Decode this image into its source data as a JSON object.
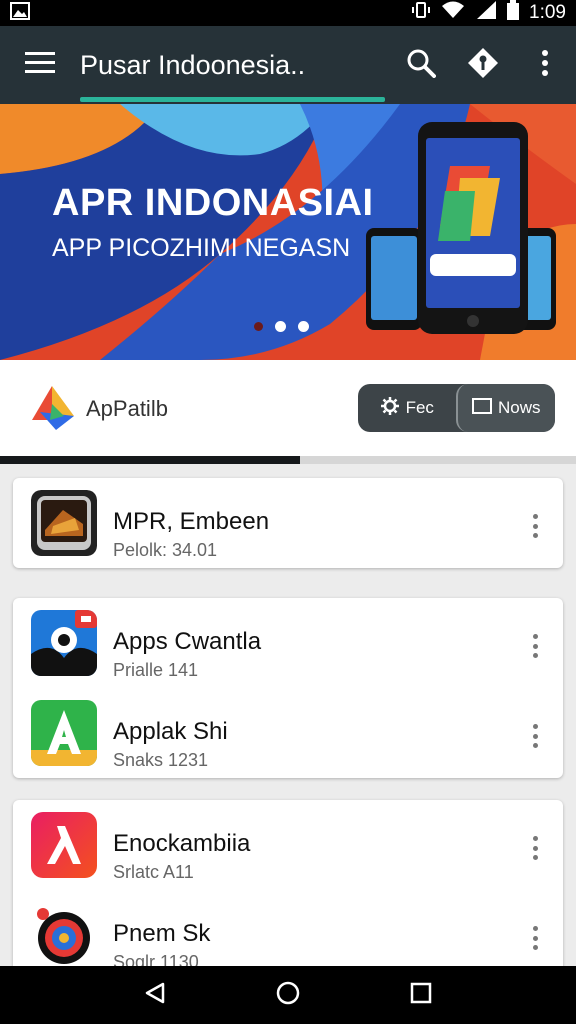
{
  "status_bar": {
    "time": "1:09",
    "left_icons": [
      "image-icon"
    ],
    "right_icons": [
      "vibrate-icon",
      "wifi-icon",
      "signal-icon",
      "battery-icon"
    ]
  },
  "toolbar": {
    "title": "Pusar Indoonesia..",
    "icons": [
      "menu-icon",
      "search-icon",
      "shield-icon",
      "more-vert-icon"
    ],
    "colors": {
      "background": "#263238",
      "underline": "#2bb39a"
    }
  },
  "banner": {
    "title": "APR INDONASIAI",
    "subtitle": "APP PICOZHIMI NEGASN",
    "carousel_pages": 3,
    "carousel_active_index": 0
  },
  "brand": {
    "name": "ApPatilb",
    "segments": [
      {
        "label": "Fec",
        "icon": "gear-icon",
        "selected": false
      },
      {
        "label": "Nows",
        "icon": "window-icon",
        "selected": true
      }
    ],
    "progress_fraction": 0.52
  },
  "apps": [
    {
      "name": "MPR, Embeen",
      "meta": "Pelolk: 34.01",
      "icon": "tablet-app-icon"
    },
    {
      "name": "Apps Cwantla",
      "meta": "Prialle 141",
      "icon": "camera-app-icon"
    },
    {
      "name": "Applak Shi",
      "meta": "Snaks 1231",
      "icon": "letter-a-app-icon"
    },
    {
      "name": "Enockambiia",
      "meta": "Srlatc A11",
      "icon": "lambda-app-icon"
    },
    {
      "name": "Pnem Sk",
      "meta": "Soglr 1130",
      "icon": "target-app-icon"
    }
  ],
  "nav_bar": {
    "icons": [
      "back-icon",
      "home-icon",
      "recents-icon"
    ]
  }
}
